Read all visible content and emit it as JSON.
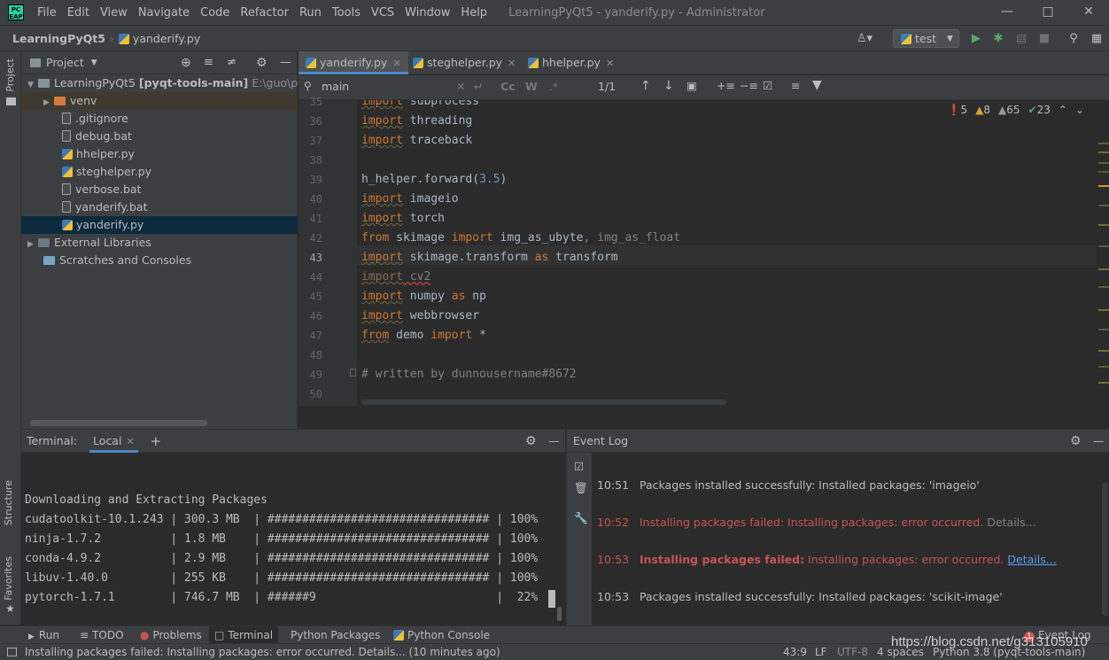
{
  "app": {
    "logo_text": "PC EAP",
    "menu": [
      "File",
      "Edit",
      "View",
      "Navigate",
      "Code",
      "Refactor",
      "Run",
      "Tools",
      "VCS",
      "Window",
      "Help"
    ],
    "window_title": "LearningPyQt5 - yanderify.py - Administrator"
  },
  "navbar": {
    "root": "LearningPyQt5",
    "file": "yanderify.py",
    "run_config": "test"
  },
  "sidebar": {
    "project_tab": "Project",
    "structure_tab": "Structure",
    "favorites_tab": "Favorites"
  },
  "project": {
    "title": "Project",
    "root_name": "LearningPyQt5",
    "root_module": "[pyqt-tools-main]",
    "root_path": "E:\\guo\\pyth",
    "items": [
      {
        "label": "venv"
      },
      {
        "label": ".gitignore"
      },
      {
        "label": "debug.bat"
      },
      {
        "label": "hhelper.py"
      },
      {
        "label": "steghelper.py"
      },
      {
        "label": "verbose.bat"
      },
      {
        "label": "yanderify.bat"
      },
      {
        "label": "yanderify.py"
      }
    ],
    "external_libraries": "External Libraries",
    "scratches": "Scratches and Consoles"
  },
  "editor": {
    "tabs": [
      "yanderify.py",
      "steghelper.py",
      "hhelper.py"
    ],
    "search_value": "main",
    "match_count": "1/1",
    "inspections": {
      "errors": "5",
      "warnings": "8",
      "weak": "65",
      "typos": "23"
    },
    "lines": [
      {
        "n": "35",
        "kw": "import",
        "rest": " subprocess"
      },
      {
        "n": "36",
        "kw": "import",
        "rest": " threading"
      },
      {
        "n": "37",
        "kw": "import",
        "rest": " traceback"
      },
      {
        "n": "38",
        "kw": "",
        "rest": ""
      },
      {
        "n": "39",
        "pre": "h_helper.forward(",
        "num": "3.5",
        "post": ")"
      },
      {
        "n": "40",
        "kw": "import",
        "rest": " imageio"
      },
      {
        "n": "41",
        "kw": "import",
        "rest": " torch"
      },
      {
        "n": "42",
        "kw": "from",
        "rest": " skimage ",
        "kw2": "import",
        "rest2": " img_as_ubyte",
        "grey": ", img_as_float"
      },
      {
        "n": "43",
        "kw": "import",
        "rest": " skimage.transform ",
        "kw2": "as",
        "rest2": " transform"
      },
      {
        "n": "44",
        "kw": "import",
        "rest": " cv2"
      },
      {
        "n": "45",
        "kw": "import",
        "rest": " numpy ",
        "kw2": "as",
        "rest2": " np"
      },
      {
        "n": "46",
        "kw": "import",
        "rest": " webbrowser"
      },
      {
        "n": "47",
        "kw": "from",
        "rest": " demo ",
        "kw2": "import",
        "rest2": " *"
      },
      {
        "n": "48",
        "kw": "",
        "rest": ""
      },
      {
        "n": "49",
        "comment": "# written by dunnousername#8672"
      },
      {
        "n": "50",
        "kw": "",
        "rest": ""
      }
    ]
  },
  "terminal": {
    "title": "Terminal:",
    "tab": "Local",
    "heading": "Downloading and Extracting Packages",
    "rows": [
      "cudatoolkit-10.1.243 | 300.3 MB  | ################################ | 100%",
      "ninja-1.7.2          | 1.8 MB    | ################################ | 100%",
      "conda-4.9.2          | 2.9 MB    | ################################ | 100%",
      "libuv-1.40.0         | 255 KB    | ################################ | 100%",
      "pytorch-1.7.1        | 746.7 MB  | ######9                          |  22%"
    ]
  },
  "event_log": {
    "title": "Event Log",
    "entries": [
      {
        "time": "10:51",
        "text": "Packages installed successfully: Installed packages: 'imageio'"
      },
      {
        "time": "10:52",
        "text": "Installing packages failed: Installing packages: error occurred.",
        "link": "Details..."
      },
      {
        "time": "10:53",
        "bold": "Installing packages failed:",
        "text": " Installing packages: error occurred.",
        "link": "Details..."
      },
      {
        "time": "10:53",
        "text": "Packages installed successfully: Installed packages: 'scikit-image'"
      }
    ]
  },
  "bottom_tabs": [
    "Run",
    "TODO",
    "Problems",
    "Terminal",
    "Python Packages",
    "Python Console"
  ],
  "event_log_tab": {
    "label": "Event Log",
    "count": "1"
  },
  "status": {
    "message": "Installing packages failed: Installing packages: error occurred. Details... (10 minutes ago)",
    "position": "43:9",
    "line_sep": "LF",
    "encoding": "UTF-8",
    "indent": "4 spaces",
    "interpreter": "Python 3.8 (pyqt-tools-main)"
  },
  "watermark": "https://blog.csdn.net/g313105910",
  "colors": {
    "accent": "#4a88c7",
    "error": "#c75450",
    "keyword": "#cc7832",
    "run_green": "#59a869"
  }
}
